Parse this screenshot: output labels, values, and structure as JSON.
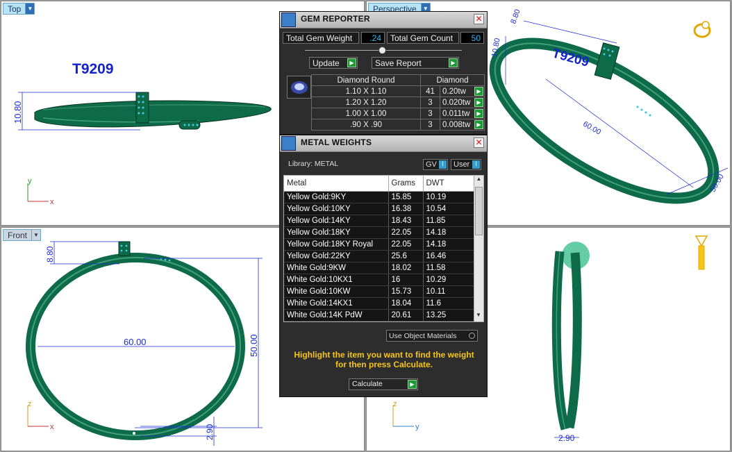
{
  "viewports": {
    "top": {
      "tab": "Top",
      "title": "T9209",
      "dim_height": "10.80"
    },
    "perspective": {
      "tab": "Perspective",
      "title": "T9209",
      "dim_a": "8.80",
      "dim_b": "10.80",
      "dim_c": "60.00",
      "dim_d": "50.00"
    },
    "front": {
      "tab": "Front",
      "dim_top": "8.80",
      "dim_width": "60.00",
      "dim_height": "50.00",
      "dim_bottom": "2.90"
    },
    "right": {
      "dim_bottom": "2.90"
    }
  },
  "axes": {
    "x": "x",
    "y": "y",
    "z": "z"
  },
  "gem_reporter": {
    "title": "GEM REPORTER",
    "close": "✕",
    "total_gem_weight_label": "Total Gem Weight",
    "total_gem_weight": ".24",
    "total_gem_count_label": "Total Gem Count",
    "total_gem_count": "50",
    "update_label": "Update",
    "save_report_label": "Save Report",
    "col_shape": "Diamond Round",
    "col_type": "Diamond",
    "rows": [
      {
        "size": "1.10 X 1.10",
        "count": "41",
        "weight": "0.20tw"
      },
      {
        "size": "1.20 X 1.20",
        "count": "3",
        "weight": "0.020tw"
      },
      {
        "size": "1.00 X 1.00",
        "count": "3",
        "weight": "0.011tw"
      },
      {
        "size": ".90 X .90",
        "count": "3",
        "weight": "0.008tw"
      }
    ]
  },
  "metal_weights": {
    "title": "METAL WEIGHTS",
    "close": "✕",
    "library_label": "Library: METAL",
    "gv_label": "GV",
    "user_label": "User",
    "toggle_glyph": "I",
    "col_metal": "Metal",
    "col_grams": "Grams",
    "col_dwt": "DWT",
    "rows": [
      {
        "metal": "Yellow Gold:9KY",
        "grams": "15.85",
        "dwt": "10.19"
      },
      {
        "metal": "Yellow Gold:10KY",
        "grams": "16.38",
        "dwt": "10.54"
      },
      {
        "metal": "Yellow Gold:14KY",
        "grams": "18.43",
        "dwt": "11.85"
      },
      {
        "metal": "Yellow Gold:18KY",
        "grams": "22.05",
        "dwt": "14.18"
      },
      {
        "metal": "Yellow Gold:18KY Royal",
        "grams": "22.05",
        "dwt": "14.18"
      },
      {
        "metal": "Yellow Gold:22KY",
        "grams": "25.6",
        "dwt": "16.46"
      },
      {
        "metal": "White Gold:9KW",
        "grams": "18.02",
        "dwt": "11.58"
      },
      {
        "metal": "White Gold:10KX1",
        "grams": "16",
        "dwt": "10.29"
      },
      {
        "metal": "White Gold:10KW",
        "grams": "15.73",
        "dwt": "10.11"
      },
      {
        "metal": "White Gold:14KX1",
        "grams": "18.04",
        "dwt": "11.6"
      },
      {
        "metal": "White Gold:14K PdW",
        "grams": "20.61",
        "dwt": "13.25"
      }
    ],
    "use_object_materials": "Use Object Materials",
    "hint": "Highlight the item you want to find the weight for then press Calculate.",
    "calculate_label": "Calculate"
  },
  "colors": {
    "bangle": "#0e6b4a",
    "highlight": "#f5c518",
    "dim": "#1a2bd6",
    "accent": "#38b9ef"
  }
}
